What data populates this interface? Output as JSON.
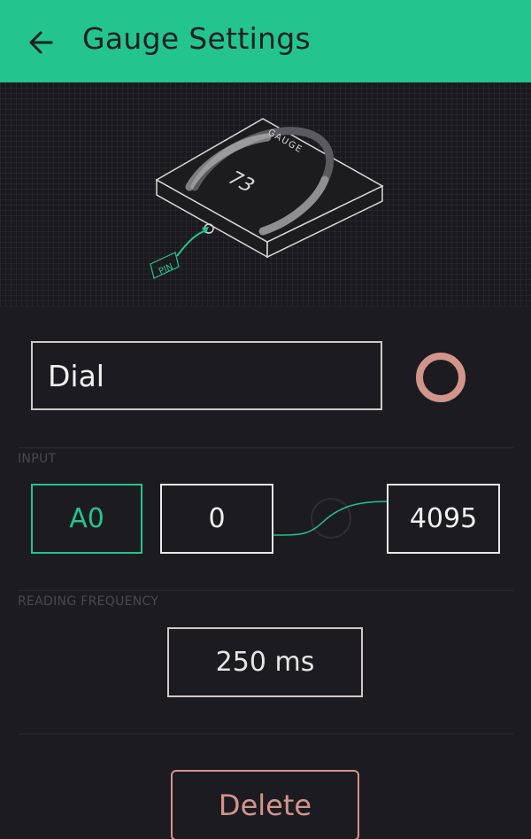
{
  "header": {
    "title": "Gauge Settings",
    "background": "#23c48e",
    "back_icon": "arrow-left-icon"
  },
  "preview": {
    "widget_label": "GAUGE",
    "gauge_value": "73",
    "pin_label": "PIN",
    "gauge_fill_fraction": 0.73
  },
  "widget": {
    "name_value": "Dial",
    "color": "#d2958a"
  },
  "input": {
    "section_label": "INPUT",
    "pin": "A0",
    "min": "0",
    "max": "4095"
  },
  "frequency": {
    "section_label": "READING FREQUENCY",
    "value": "250 ms"
  },
  "actions": {
    "delete_label": "Delete"
  }
}
